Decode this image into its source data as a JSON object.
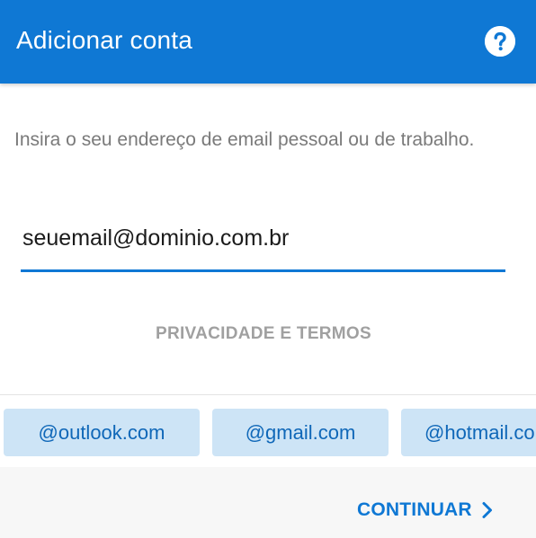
{
  "header": {
    "title": "Adicionar conta",
    "help_icon": "question-circle-icon"
  },
  "main": {
    "instruction": "Insira o seu endereço de email pessoal ou de trabalho.",
    "email_input": {
      "value": "seuemail@dominio.com.br"
    },
    "privacy_link": "PRIVACIDADE E TERMOS"
  },
  "suggestions": [
    {
      "label": "@outlook.com"
    },
    {
      "label": "@gmail.com"
    },
    {
      "label": "@hotmail.com"
    }
  ],
  "footer": {
    "continue_label": "CONTINUAR",
    "continue_icon": "chevron-right-icon"
  },
  "colors": {
    "accent": "#0f78d4",
    "chip_background": "#cde4f6",
    "chip_text": "#0f67b8",
    "muted_text": "#7a7a7a"
  }
}
